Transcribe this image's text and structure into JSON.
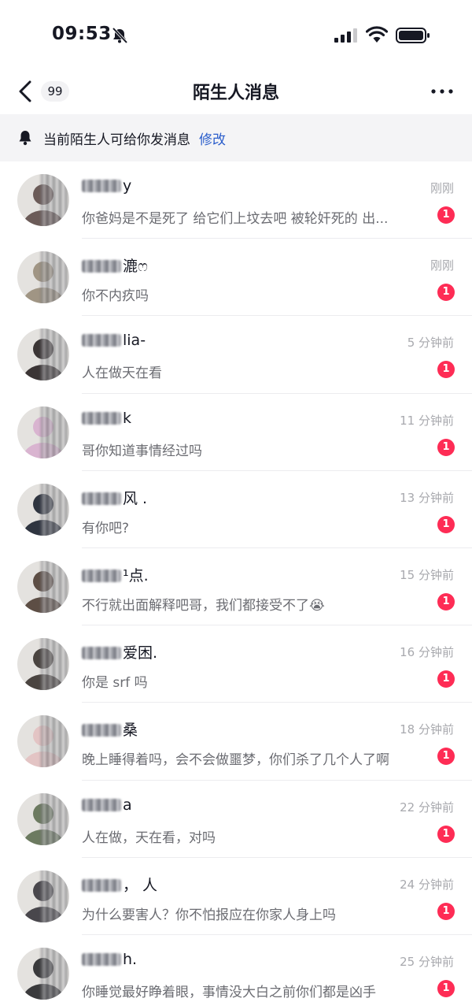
{
  "status_bar": {
    "time": "09:53"
  },
  "nav": {
    "unread_count": "99",
    "title": "陌生人消息"
  },
  "notice": {
    "text": "当前陌生人可给你发消息",
    "action": "修改"
  },
  "colors": {
    "accent": "#fe2c55",
    "link": "#2a5dcb",
    "muted": "#a8a9ae"
  },
  "conversations": [
    {
      "name": "y",
      "time": "刚刚",
      "preview": "你爸妈是不是死了 给它们上坟去吧 被轮奸死的 出...",
      "badge": "1",
      "avatar": "#6b5b58"
    },
    {
      "name": "漉ෆ",
      "time": "刚刚",
      "preview": "你不内疚吗",
      "badge": "1",
      "avatar": "#a09584"
    },
    {
      "name": "lia-",
      "time": "5 分钟前",
      "preview": "人在做天在看",
      "badge": "1",
      "avatar": "#3b3535"
    },
    {
      "name": "k",
      "time": "11 分钟前",
      "preview": "哥你知道事情经过吗",
      "badge": "1",
      "avatar": "#d9b4d0"
    },
    {
      "name": "风      .",
      "time": "13 分钟前",
      "preview": "有你吧?",
      "badge": "1",
      "avatar": "#2f3540"
    },
    {
      "name": "¹点.",
      "time": "15 分钟前",
      "preview": "不行就出面解释吧哥，我们都接受不了😭",
      "badge": "1",
      "avatar": "#5d4e45"
    },
    {
      "name": "爱困.",
      "time": "16 分钟前",
      "preview": "你是 srf 吗",
      "badge": "1",
      "avatar": "#4a4440"
    },
    {
      "name": "桑",
      "time": "18 分钟前",
      "preview": " 晚上睡得着吗，会不会做噩梦，你们杀了几个人了啊",
      "badge": "1",
      "avatar": "#e3c4c4"
    },
    {
      "name": "a",
      "time": "22 分钟前",
      "preview": "人在做，天在看，对吗",
      "badge": "1",
      "avatar": "#6c7a60"
    },
    {
      "name": "，    人",
      "time": "24 分钟前",
      "preview": "为什么要害人？你不怕报应在你家人身上吗",
      "badge": "1",
      "avatar": "#49474c"
    },
    {
      "name": "h.",
      "time": "25 分钟前",
      "preview": "你睡觉最好睁着眼，事情没大白之前你们都是凶手",
      "badge": "1",
      "avatar": "#3a3a3c"
    }
  ]
}
